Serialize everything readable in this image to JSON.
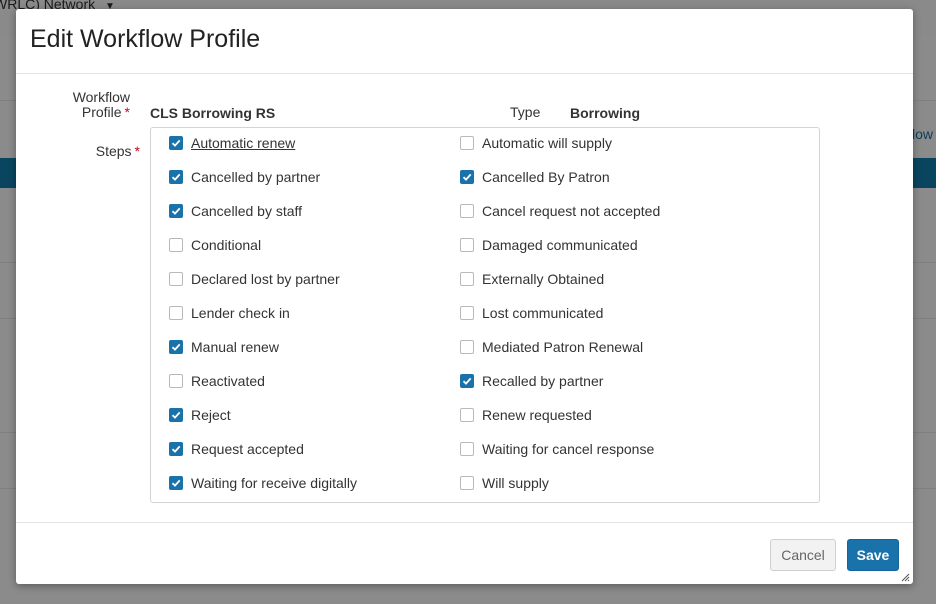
{
  "background": {
    "network_label": "WRLC) Network",
    "dropdown_icon": "caret-down-icon",
    "right_partial_text": "low"
  },
  "modal": {
    "title": "Edit Workflow Profile",
    "fields": {
      "workflow_profile_label_line1": "Workflow",
      "workflow_profile_label_line2": "Profile",
      "required_marker": "*",
      "workflow_profile_value": "CLS Borrowing RS",
      "type_label": "Type",
      "type_value": "Borrowing",
      "steps_label": "Steps"
    },
    "steps_left": [
      {
        "label": "Automatic renew",
        "checked": true
      },
      {
        "label": "Cancelled by partner",
        "checked": true
      },
      {
        "label": "Cancelled by staff",
        "checked": true
      },
      {
        "label": "Conditional",
        "checked": false
      },
      {
        "label": "Declared lost by partner",
        "checked": false
      },
      {
        "label": "Lender check in",
        "checked": false
      },
      {
        "label": "Manual renew",
        "checked": true
      },
      {
        "label": "Reactivated",
        "checked": false
      },
      {
        "label": "Reject",
        "checked": true
      },
      {
        "label": "Request accepted",
        "checked": true
      },
      {
        "label": "Waiting for receive digitally",
        "checked": true
      }
    ],
    "steps_right": [
      {
        "label": "Automatic will supply",
        "checked": false
      },
      {
        "label": "Cancelled By Patron",
        "checked": true
      },
      {
        "label": "Cancel request not accepted",
        "checked": false
      },
      {
        "label": "Damaged communicated",
        "checked": false
      },
      {
        "label": "Externally Obtained",
        "checked": false
      },
      {
        "label": "Lost communicated",
        "checked": false
      },
      {
        "label": "Mediated Patron Renewal",
        "checked": false
      },
      {
        "label": "Recalled by partner",
        "checked": true
      },
      {
        "label": "Renew requested",
        "checked": false
      },
      {
        "label": "Waiting for cancel response",
        "checked": false
      },
      {
        "label": "Will supply",
        "checked": false
      }
    ],
    "footer": {
      "cancel_label": "Cancel",
      "save_label": "Save"
    }
  },
  "colors": {
    "accent": "#1a72ab",
    "required": "#d0021b",
    "overlay": "#8b8b8b"
  }
}
